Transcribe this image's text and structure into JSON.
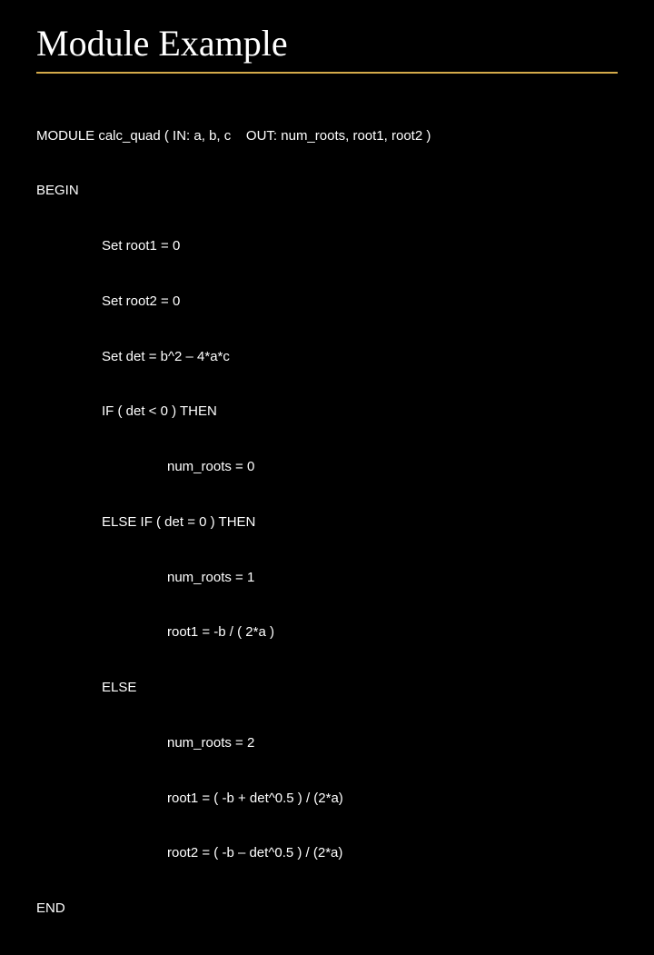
{
  "title": "Module Example",
  "code": {
    "l0": "MODULE calc_quad ( IN: a, b, c    OUT: num_roots, root1, root2 )",
    "l1": "BEGIN",
    "l2": "Set root1 = 0",
    "l3": "Set root2 = 0",
    "l4": "Set det = b^2 – 4*a*c",
    "l5": "IF ( det < 0 ) THEN",
    "l6": "num_roots = 0",
    "l7": "ELSE IF ( det = 0 ) THEN",
    "l8": "num_roots = 1",
    "l9": "root1 = -b / ( 2*a )",
    "l10": "ELSE",
    "l11": "num_roots = 2",
    "l12": "root1 = ( -b + det^0.5 ) / (2*a)",
    "l13": "root2 = ( -b – det^0.5 ) / (2*a)",
    "l14": "END"
  }
}
